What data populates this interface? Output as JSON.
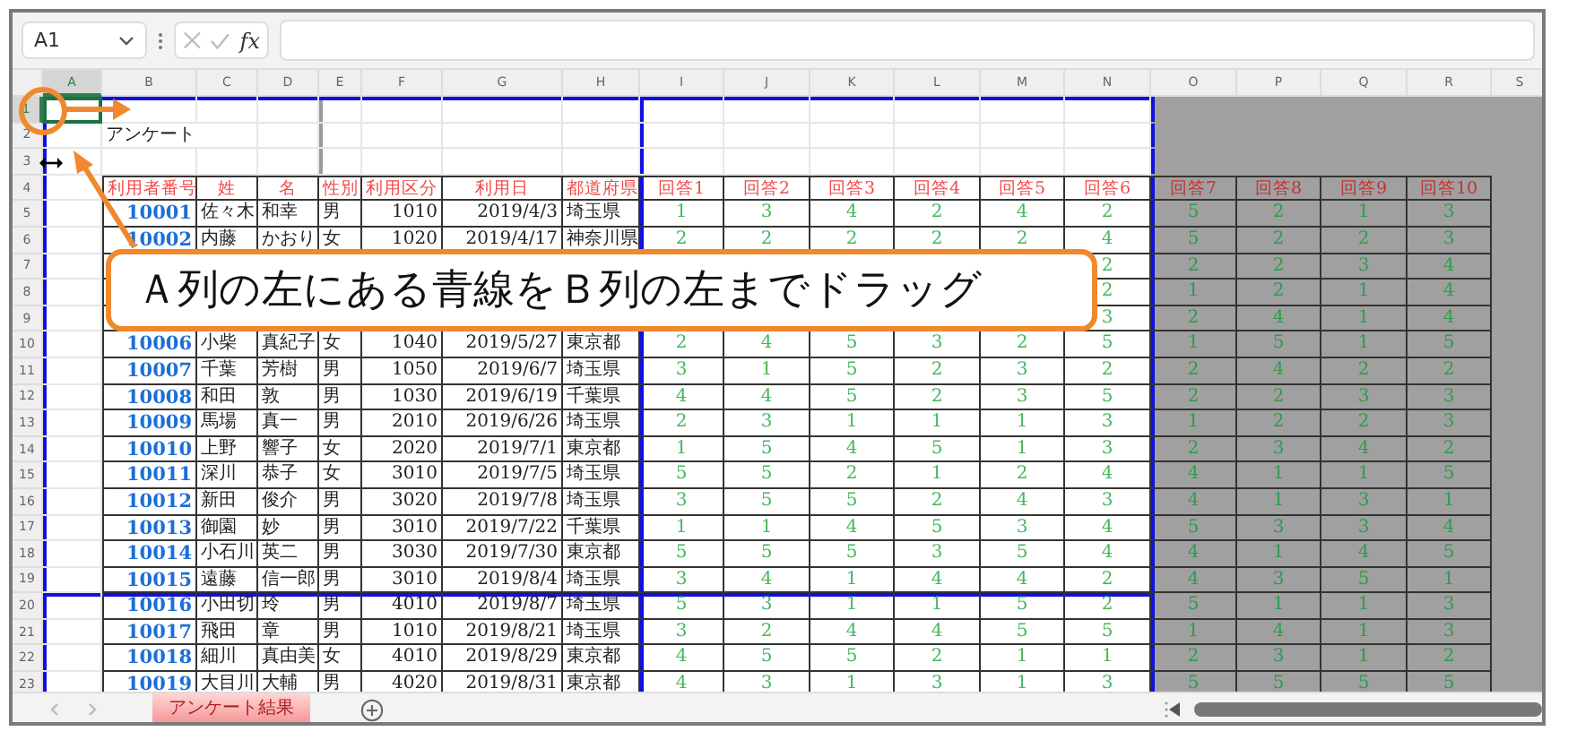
{
  "formula_bar": {
    "name_box": "A1",
    "function_label": "fx"
  },
  "column_letters": [
    "A",
    "B",
    "C",
    "D",
    "E",
    "F",
    "G",
    "H",
    "I",
    "J",
    "K",
    "L",
    "M",
    "N",
    "O",
    "P",
    "Q",
    "R",
    "S"
  ],
  "row_numbers": [
    "1",
    "2",
    "3",
    "4",
    "5",
    "6",
    "7",
    "8",
    "9",
    "10",
    "11",
    "12",
    "13",
    "14",
    "15",
    "16",
    "17",
    "18",
    "19",
    "20",
    "21",
    "22",
    "23"
  ],
  "sheet_title": "アンケート",
  "table": {
    "columns": [
      "利用者番号",
      "姓",
      "名",
      "性別",
      "利用区分",
      "利用日",
      "都道府県",
      "回答1",
      "回答2",
      "回答3",
      "回答4",
      "回答5",
      "回答6",
      "回答7",
      "回答8",
      "回答9",
      "回答10"
    ],
    "rows": [
      {
        "id": "10001",
        "last_name": "佐々木",
        "first_name": "和幸",
        "gender": "男",
        "usage_class": "1010",
        "date": "2019/4/3",
        "prefecture": "埼玉県",
        "answers": [
          "1",
          "3",
          "4",
          "2",
          "4",
          "2",
          "5",
          "2",
          "1",
          "3"
        ]
      },
      {
        "id": "10002",
        "last_name": "内藤",
        "first_name": "かおり",
        "gender": "女",
        "usage_class": "1020",
        "date": "2019/4/17",
        "prefecture": "神奈川県",
        "answers": [
          "2",
          "2",
          "2",
          "2",
          "2",
          "4",
          "5",
          "2",
          "2",
          "3"
        ]
      },
      {
        "answers": [
          "2",
          "2",
          "2",
          "3",
          "4"
        ]
      },
      {
        "answers": [
          "2",
          "1",
          "2",
          "1",
          "4"
        ]
      },
      {
        "answers": [
          "3",
          "2",
          "4",
          "1",
          "4"
        ]
      },
      {
        "id": "10006",
        "last_name": "小柴",
        "first_name": "真紀子",
        "gender": "女",
        "usage_class": "1040",
        "date": "2019/5/27",
        "prefecture": "東京都",
        "answers": [
          "2",
          "4",
          "5",
          "3",
          "2",
          "5",
          "1",
          "5",
          "1",
          "5"
        ]
      },
      {
        "id": "10007",
        "last_name": "千葉",
        "first_name": "芳樹",
        "gender": "男",
        "usage_class": "1050",
        "date": "2019/6/7",
        "prefecture": "埼玉県",
        "answers": [
          "3",
          "1",
          "5",
          "2",
          "3",
          "2",
          "2",
          "4",
          "2",
          "2"
        ]
      },
      {
        "id": "10008",
        "last_name": "和田",
        "first_name": "敦",
        "gender": "男",
        "usage_class": "1030",
        "date": "2019/6/19",
        "prefecture": "千葉県",
        "answers": [
          "4",
          "4",
          "5",
          "2",
          "3",
          "5",
          "2",
          "2",
          "3",
          "3"
        ]
      },
      {
        "id": "10009",
        "last_name": "馬場",
        "first_name": "真一",
        "gender": "男",
        "usage_class": "2010",
        "date": "2019/6/26",
        "prefecture": "埼玉県",
        "answers": [
          "2",
          "3",
          "1",
          "1",
          "1",
          "3",
          "1",
          "2",
          "2",
          "3"
        ]
      },
      {
        "id": "10010",
        "last_name": "上野",
        "first_name": "響子",
        "gender": "女",
        "usage_class": "2020",
        "date": "2019/7/1",
        "prefecture": "東京都",
        "answers": [
          "1",
          "5",
          "4",
          "5",
          "1",
          "3",
          "2",
          "3",
          "4",
          "2"
        ]
      },
      {
        "id": "10011",
        "last_name": "深川",
        "first_name": "恭子",
        "gender": "女",
        "usage_class": "3010",
        "date": "2019/7/5",
        "prefecture": "埼玉県",
        "answers": [
          "5",
          "5",
          "2",
          "1",
          "2",
          "4",
          "4",
          "1",
          "1",
          "5"
        ]
      },
      {
        "id": "10012",
        "last_name": "新田",
        "first_name": "俊介",
        "gender": "男",
        "usage_class": "3020",
        "date": "2019/7/8",
        "prefecture": "埼玉県",
        "answers": [
          "3",
          "5",
          "5",
          "2",
          "4",
          "3",
          "4",
          "1",
          "3",
          "1"
        ]
      },
      {
        "id": "10013",
        "last_name": "御園",
        "first_name": "妙",
        "gender": "男",
        "usage_class": "3010",
        "date": "2019/7/22",
        "prefecture": "千葉県",
        "answers": [
          "1",
          "1",
          "4",
          "5",
          "3",
          "4",
          "5",
          "3",
          "3",
          "4"
        ]
      },
      {
        "id": "10014",
        "last_name": "小石川",
        "first_name": "英二",
        "gender": "男",
        "usage_class": "3030",
        "date": "2019/7/30",
        "prefecture": "東京都",
        "answers": [
          "5",
          "5",
          "5",
          "3",
          "5",
          "4",
          "4",
          "1",
          "4",
          "5"
        ]
      },
      {
        "id": "10015",
        "last_name": "遠藤",
        "first_name": "信一郎",
        "gender": "男",
        "usage_class": "3010",
        "date": "2019/8/4",
        "prefecture": "埼玉県",
        "answers": [
          "3",
          "4",
          "1",
          "4",
          "4",
          "2",
          "4",
          "3",
          "5",
          "1"
        ]
      },
      {
        "id": "10016",
        "last_name": "小田切",
        "first_name": "玲",
        "gender": "男",
        "usage_class": "4010",
        "date": "2019/8/7",
        "prefecture": "埼玉県",
        "answers": [
          "5",
          "3",
          "1",
          "1",
          "5",
          "2",
          "5",
          "1",
          "1",
          "3"
        ]
      },
      {
        "id": "10017",
        "last_name": "飛田",
        "first_name": "章",
        "gender": "男",
        "usage_class": "1010",
        "date": "2019/8/21",
        "prefecture": "埼玉県",
        "answers": [
          "3",
          "2",
          "4",
          "4",
          "5",
          "5",
          "1",
          "4",
          "1",
          "3"
        ]
      },
      {
        "id": "10018",
        "last_name": "細川",
        "first_name": "真由美",
        "gender": "女",
        "usage_class": "4010",
        "date": "2019/8/29",
        "prefecture": "東京都",
        "answers": [
          "4",
          "5",
          "5",
          "2",
          "1",
          "1",
          "2",
          "3",
          "1",
          "2"
        ]
      },
      {
        "id": "10019",
        "last_name": "大目川",
        "first_name": "大輔",
        "gender": "男",
        "usage_class": "4020",
        "date": "2019/8/31",
        "prefecture": "東京都",
        "answers": [
          "4",
          "3",
          "1",
          "3",
          "1",
          "3",
          "5",
          "5",
          "5",
          "5"
        ]
      }
    ]
  },
  "callout": {
    "text": "Ａ列の左にある青線をＢ列の左までドラッグ"
  },
  "sheet_tabs": [
    {
      "label": "アンケート結果",
      "selected": true
    }
  ]
}
